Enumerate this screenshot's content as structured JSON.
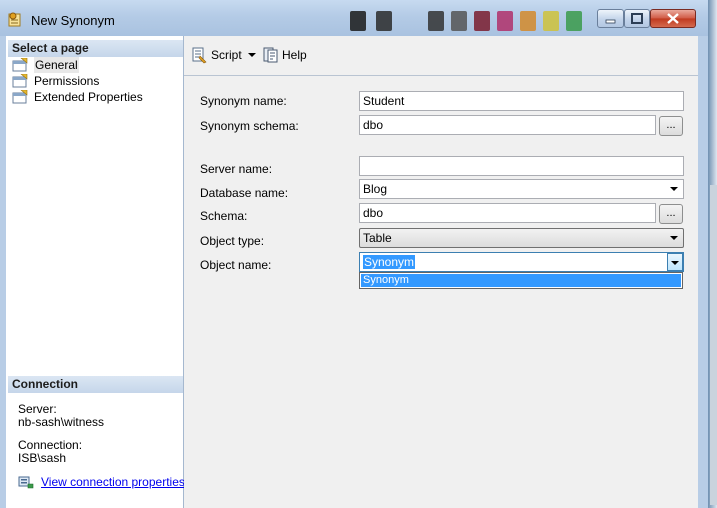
{
  "window": {
    "title": "New Synonym"
  },
  "left_panel": {
    "select_page_header": "Select a page",
    "pages": [
      {
        "label": "General",
        "selected": true
      },
      {
        "label": "Permissions"
      },
      {
        "label": "Extended Properties"
      }
    ],
    "connection_header": "Connection",
    "server_label": "Server:",
    "server_value": "nb-sash\\witness",
    "connection_label": "Connection:",
    "connection_value": "ISB\\sash",
    "view_connection_link": "View connection properties"
  },
  "toolbar": {
    "script_label": "Script",
    "help_label": "Help"
  },
  "form": {
    "synonym_name_label": "Synonym name:",
    "synonym_name_value": "Student",
    "synonym_schema_label": "Synonym schema:",
    "synonym_schema_value": "dbo",
    "server_name_label": "Server name:",
    "server_name_value": "",
    "database_name_label": "Database name:",
    "database_name_value": "Blog",
    "schema_label": "Schema:",
    "schema_value": "dbo",
    "object_type_label": "Object type:",
    "object_type_value": "Table",
    "object_name_label": "Object name:",
    "object_name_value": "Synonym",
    "object_name_options": [
      "Synonym"
    ],
    "ellipsis_label": "..."
  },
  "colors": {
    "selection": "#3399ff",
    "link": "#0000ee",
    "panel_header": "#c5d6ea",
    "close_button": "#c0391f"
  },
  "icons": {
    "title": "synonym-icon",
    "page": "property-page-icon",
    "script": "script-icon",
    "help": "help-icon",
    "connection": "connection-properties-icon"
  }
}
